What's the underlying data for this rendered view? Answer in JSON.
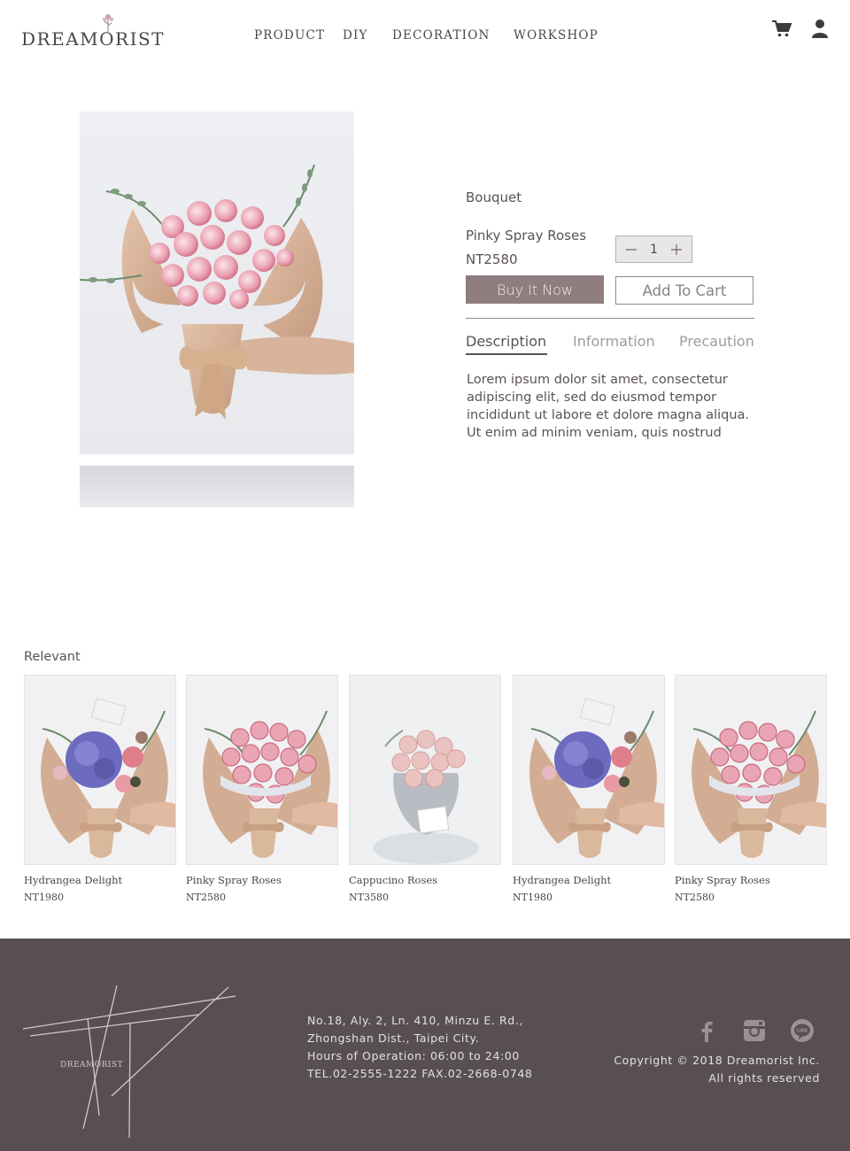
{
  "header": {
    "logo_text": "DREAMORIST",
    "nav": [
      "PRODUCT",
      "DIY",
      "DECORATION",
      "WORKSHOP"
    ],
    "icons": [
      "cart-icon",
      "user-icon"
    ]
  },
  "product": {
    "category": "Bouquet",
    "name": "Pinky Spray Roses",
    "price": "NT2580",
    "quantity": "1",
    "buy_label": "Buy It Now",
    "cart_label": "Add To Cart",
    "tabs": [
      "Description",
      "Information",
      "Precaution"
    ],
    "active_tab": "Description",
    "description": "Lorem ipsum dolor sit amet, consectetur adipiscing elit, sed do eiusmod tempor incididunt ut labore et dolore magna aliqua. Ut enim ad minim veniam, quis nostrud"
  },
  "relevant": {
    "title": "Relevant",
    "items": [
      {
        "name": "Hydrangea Delight",
        "price": "NT1980",
        "kind": "hydrangea"
      },
      {
        "name": "Pinky Spray Roses",
        "price": "NT2580",
        "kind": "roses"
      },
      {
        "name": "Cappucino Roses",
        "price": "NT3580",
        "kind": "cappucino"
      },
      {
        "name": "Hydrangea Delight",
        "price": "NT1980",
        "kind": "hydrangea"
      },
      {
        "name": "Pinky Spray Roses",
        "price": "NT2580",
        "kind": "roses"
      }
    ]
  },
  "footer": {
    "logo_text": "DREAMORIST",
    "address_lines": [
      "No.18, Aly. 2, Ln. 410, Minzu E. Rd.,",
      "Zhongshan Dist., Taipei City.",
      "Hours of Operation: 06:00 to 24:00",
      "TEL.02-2555-1222 FAX.02-2668-0748"
    ],
    "copyright": "Copyright © 2018 Dreamorist Inc.",
    "rights": "All rights reserved",
    "social": [
      "facebook-icon",
      "instagram-icon",
      "line-icon"
    ]
  },
  "colors": {
    "accent": "#8f7d7f",
    "footer_bg": "#584f53",
    "text": "#5a5254"
  }
}
